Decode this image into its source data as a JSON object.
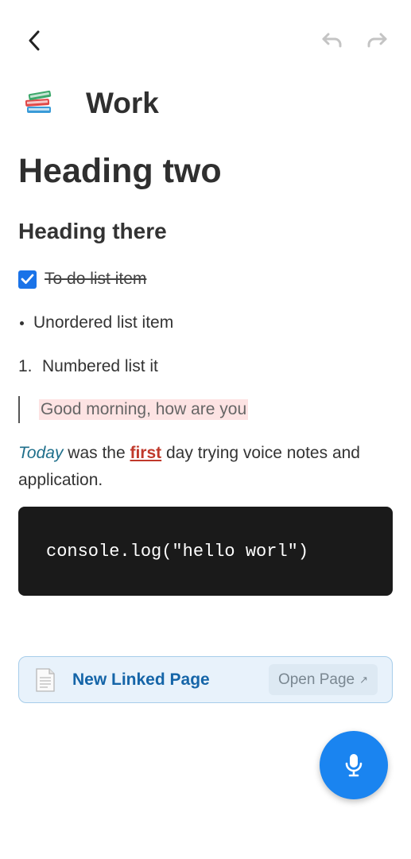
{
  "page": {
    "title": "Work",
    "icon": "books-icon"
  },
  "toolbar": {
    "back_icon": "back-icon",
    "undo_icon": "undo-icon",
    "redo_icon": "redo-icon"
  },
  "content": {
    "heading_two": "Heading two",
    "heading_three": "Heading there",
    "todo": {
      "label": "To do list item",
      "checked": true
    },
    "bullet_item": "Unordered list item",
    "numbered_item": {
      "marker": "1.",
      "label": "Numbered list it"
    },
    "quote": "Good morning, how are you",
    "paragraph": {
      "italic": "Today",
      "part1": " was the ",
      "strong": "first",
      "part2": " day trying voice notes and application."
    },
    "code": "console.log(\"hello worl\")"
  },
  "linked_page": {
    "title": "New Linked Page",
    "open_label": "Open Page",
    "open_arrow": "↗",
    "icon": "document-icon"
  },
  "fab": {
    "icon": "microphone-icon"
  },
  "colors": {
    "accent": "#1a84f0",
    "checkbox": "#1a73e8",
    "code_bg": "#1a1a1a",
    "link_card_bg": "#e8f2fb",
    "link_title": "#1565a8",
    "quote_highlight": "#fde3e3",
    "strong_red": "#c0392b",
    "italic_teal": "#1f6f8b"
  }
}
